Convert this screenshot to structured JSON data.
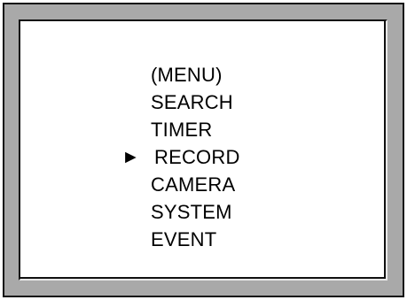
{
  "menu": {
    "title": "(MENU)",
    "cursor_glyph": "►",
    "selected_index": 2,
    "items": [
      {
        "id": "search",
        "label": "SEARCH"
      },
      {
        "id": "timer",
        "label": "TIMER"
      },
      {
        "id": "record",
        "label": "RECORD"
      },
      {
        "id": "camera",
        "label": "CAMERA"
      },
      {
        "id": "system",
        "label": "SYSTEM"
      },
      {
        "id": "event",
        "label": "EVENT"
      }
    ]
  },
  "colors": {
    "frame": "#a9a9a9",
    "screen": "#ffffff",
    "text": "#000000"
  }
}
